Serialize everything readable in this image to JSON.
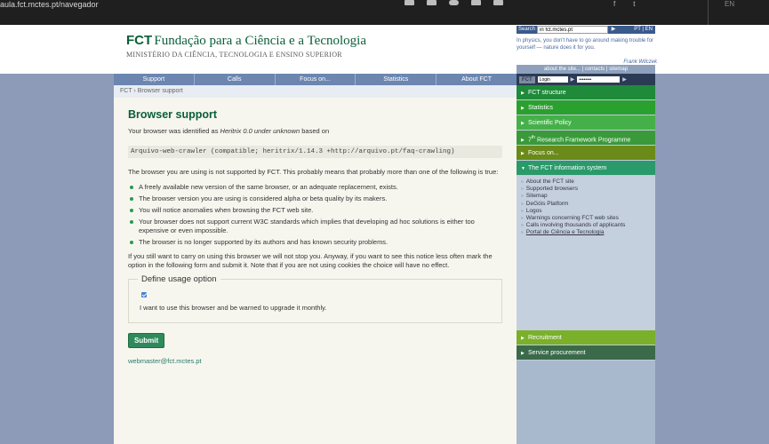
{
  "browser": {
    "url": "aula.fct.mctes.pt/navegador",
    "lang": "EN"
  },
  "header": {
    "logo_fct": "FCT",
    "logo_name": "Fundação para a Ciência e a Tecnologia",
    "logo_sub": "MINISTÉRIO DA CIÊNCIA, TECNOLOGIA E ENSINO SUPERIOR",
    "search_label": "Search",
    "search_value": "in fct.mctes.pt",
    "search_go": "▶",
    "lang_links": "PT | EN",
    "quote": "In physics, you don't have to go around making trouble for yourself — nature does it for you.",
    "quote_author": "Frank Wilczek"
  },
  "nav": {
    "items": [
      "Support",
      "Calls",
      "Focus on...",
      "Statistics",
      "About FCT"
    ]
  },
  "breadcrumb": "FCT › Browser support",
  "main": {
    "title": "Browser support",
    "p1_pre": "Your browser was identified as ",
    "p1_em": "Heritrix 0.0 under unknown",
    "p1_post": " based on",
    "user_agent": "Arquivo-web-crawler (compatible; heritrix/1.14.3 +http://arquivo.pt/faq-crawling)",
    "p2": "The browser you are using is not supported by FCT. This probably means that probably more than one of the following is true:",
    "bullets": [
      "A freely available new version of the same browser, or an adequate replacement, exists.",
      "The browser version you are using is considered alpha or beta quality by its makers.",
      "You will notice anomalies when browsing the FCT web site.",
      "Your browser does not support current W3C standards which implies that developing ad hoc solutions is either too expensive or even impossible.",
      "The browser is no longer supported by its authors and has known security problems."
    ],
    "p3": "If you still want to carry on using this browser we will not stop you. Anyway, if you want to see this notice less often mark the option in the following form and submit it. Note that if you are not using cookies the choice will have no effect.",
    "legend": "Define usage option",
    "checkbox_label": "I want to use this browser and be warned to upgrade it monthly.",
    "submit": "Submit",
    "email": "webmaster@fct.mctes.pt"
  },
  "sidebar": {
    "toplinks": "about the site... | contacts | sitemap",
    "brand": "FCT",
    "login_value": "Login",
    "password_value": "••••••••",
    "menu": [
      {
        "label": "FCT structure",
        "color": "#1f8a3a"
      },
      {
        "label": "Statistics",
        "color": "#2aa02e"
      },
      {
        "label": "Scientific Policy",
        "color": "#45b04a"
      },
      {
        "label_pre": "7",
        "label_sup": "th",
        "label": " Research Framework Programme",
        "color": "#3a9a3a"
      },
      {
        "label": "Focus on...",
        "color": "#6a8a1a"
      },
      {
        "label": "The FCT information system",
        "color": "#2a9a6a"
      }
    ],
    "submenu": [
      "About the FCT site",
      "Supported browsers",
      "Sitemap",
      "DeGóis Platform",
      "Logos",
      "Warnings concerning FCT web sites",
      "Calls involving thousands of applicants",
      "Portal de Ciência e Tecnologia"
    ],
    "bottom_menu": [
      {
        "label": "Recruitment",
        "color": "#7ab02a"
      },
      {
        "label": "Service procurement",
        "color": "#3a6a4a"
      }
    ]
  }
}
